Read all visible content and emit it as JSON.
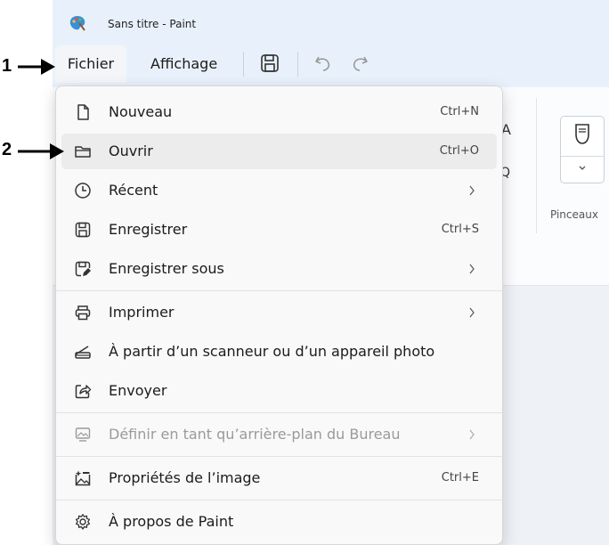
{
  "window": {
    "title": "Sans titre - Paint"
  },
  "menubar": {
    "file_label": "Fichier",
    "view_label": "Affichage"
  },
  "toolbar": {
    "icons": [
      "save-icon",
      "undo-icon",
      "redo-icon"
    ]
  },
  "ribbon": {
    "brushes_label": "Pinceaux",
    "partial_text_a": "A",
    "partial_text_q": "Q"
  },
  "file_menu": {
    "items": [
      {
        "label": "Nouveau",
        "shortcut": "Ctrl+N",
        "icon": "new-file-icon"
      },
      {
        "label": "Ouvrir",
        "shortcut": "Ctrl+O",
        "icon": "open-folder-icon",
        "highlighted": true
      },
      {
        "label": "Récent",
        "submenu": true,
        "icon": "clock-icon"
      },
      {
        "label": "Enregistrer",
        "shortcut": "Ctrl+S",
        "icon": "save-icon"
      },
      {
        "label": "Enregistrer sous",
        "submenu": true,
        "icon": "save-as-icon"
      },
      {
        "label": "Imprimer",
        "submenu": true,
        "icon": "printer-icon"
      },
      {
        "label": "À partir d’un scanneur ou d’un appareil photo",
        "icon": "scanner-icon"
      },
      {
        "label": "Envoyer",
        "icon": "share-icon"
      },
      {
        "label": "Définir en tant qu’arrière-plan du Bureau",
        "submenu": true,
        "disabled": true,
        "icon": "wallpaper-icon"
      },
      {
        "label": "Propriétés de l’image",
        "shortcut": "Ctrl+E",
        "icon": "image-properties-icon"
      },
      {
        "label": "À propos de Paint",
        "icon": "gear-icon"
      }
    ]
  },
  "annotations": [
    {
      "number": "1",
      "target": "Fichier"
    },
    {
      "number": "2",
      "target": "Ouvrir"
    }
  ],
  "colors": {
    "titlebar_bg": "#e8f1fb",
    "menu_bg": "#f9f9f9",
    "hover_bg": "#ececec",
    "disabled_text": "#9a9a9a"
  }
}
